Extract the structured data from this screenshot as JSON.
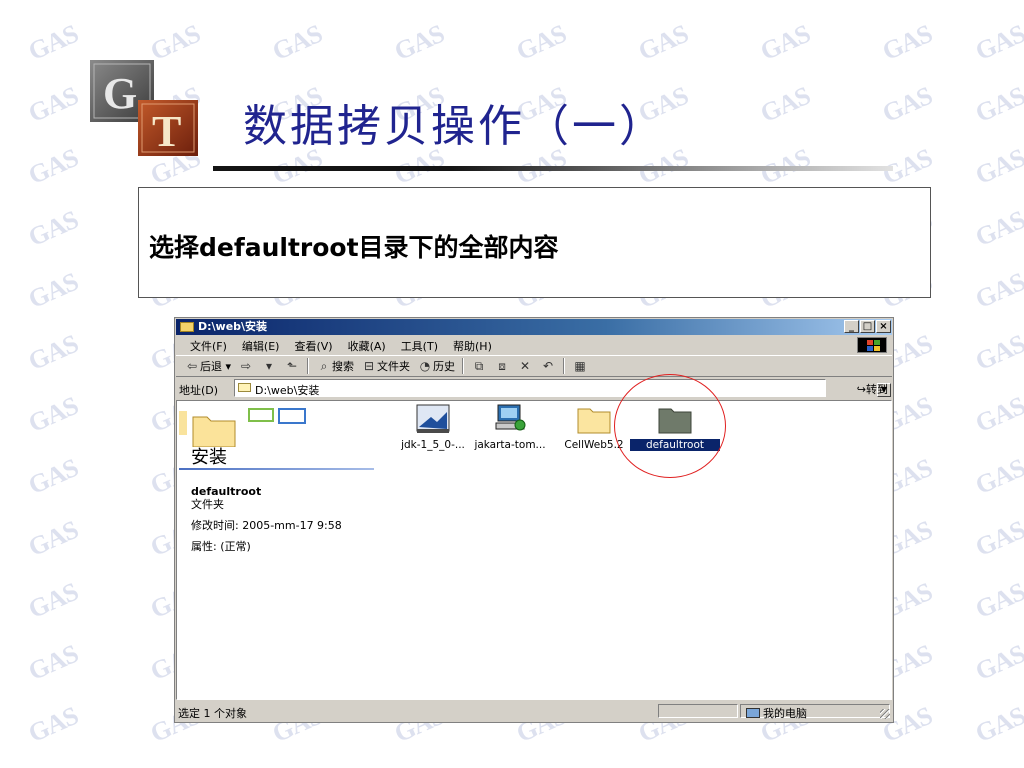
{
  "slide": {
    "title": "数据拷贝操作（一）",
    "instruction": "选择defaultroot目录下的全部内容"
  },
  "logo": {
    "text": "GT"
  },
  "watermark": {
    "text": "GAS"
  },
  "window": {
    "title": "D:\\web\\安装",
    "buttons": [
      "_",
      "□",
      "×"
    ],
    "menu": [
      "文件(F)",
      "编辑(E)",
      "查看(V)",
      "收藏(A)",
      "工具(T)",
      "帮助(H)"
    ],
    "toolbar": {
      "back": "后退",
      "search": "搜索",
      "folders": "文件夹",
      "history": "历史"
    },
    "address": {
      "label": "地址(D)",
      "value": "D:\\web\\安装",
      "go": "转到"
    },
    "panel": {
      "folder_title": "安装",
      "selected_name": "defaultroot",
      "selected_type": "文件夹",
      "modified": "修改时间: 2005-mm-17 9:58",
      "attributes": "属性: (正常)"
    },
    "items": [
      {
        "label": "jdk-1_5_0-...",
        "icon": "installer-icon"
      },
      {
        "label": "jakarta-tom...",
        "icon": "setup-computer-icon"
      },
      {
        "label": "CellWeb5.2",
        "icon": "folder-icon"
      },
      {
        "label": "defaultroot",
        "icon": "folder-icon",
        "selected": true
      }
    ],
    "status": {
      "left": "选定 1 个对象",
      "zone": "我的电脑"
    }
  },
  "colors": {
    "title_text": "#20248f",
    "titlebar_start": "#0a246a",
    "titlebar_end": "#a6caf0",
    "selection": "#0a246a",
    "highlight_circle": "#e02020",
    "watermark": "#dde1ef"
  }
}
